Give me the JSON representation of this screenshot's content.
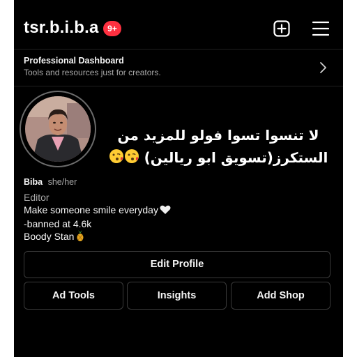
{
  "header": {
    "username": "tsr.b.i.b.a",
    "notification_badge": "9+",
    "badge_color": "#ff3040",
    "create_icon": "plus-square-icon",
    "menu_icon": "hamburger-menu-icon"
  },
  "dashboard": {
    "title": "Professional Dashboard",
    "subtitle": "Tools and resources just for creators.",
    "chevron_icon": "chevron-right-icon"
  },
  "profile": {
    "arabic_bio_line1": "لا تنسوا تسوا فولو للمزيد من",
    "arabic_bio_line2": "الستكرز(تسويق ابو ريالين)",
    "arabic_bio_emoji": "kissing-face-emoji",
    "name": "Biba",
    "pronouns": "she/her",
    "category": "Editor",
    "bio_lines": [
      "Make someone smile everyday",
      "-banned at 4.6k",
      "Boody Stan"
    ],
    "bio_line1_icon": "white-heart-icon",
    "bio_line3_icon": "pineapple-icon"
  },
  "buttons": {
    "edit_profile": "Edit Profile",
    "ad_tools": "Ad Tools",
    "insights": "Insights",
    "add_shop": "Add Shop"
  },
  "colors": {
    "background": "#000000",
    "text_primary": "#f5f5f5",
    "text_secondary": "#a8a8a8",
    "button_border": "#3a3a3a"
  }
}
